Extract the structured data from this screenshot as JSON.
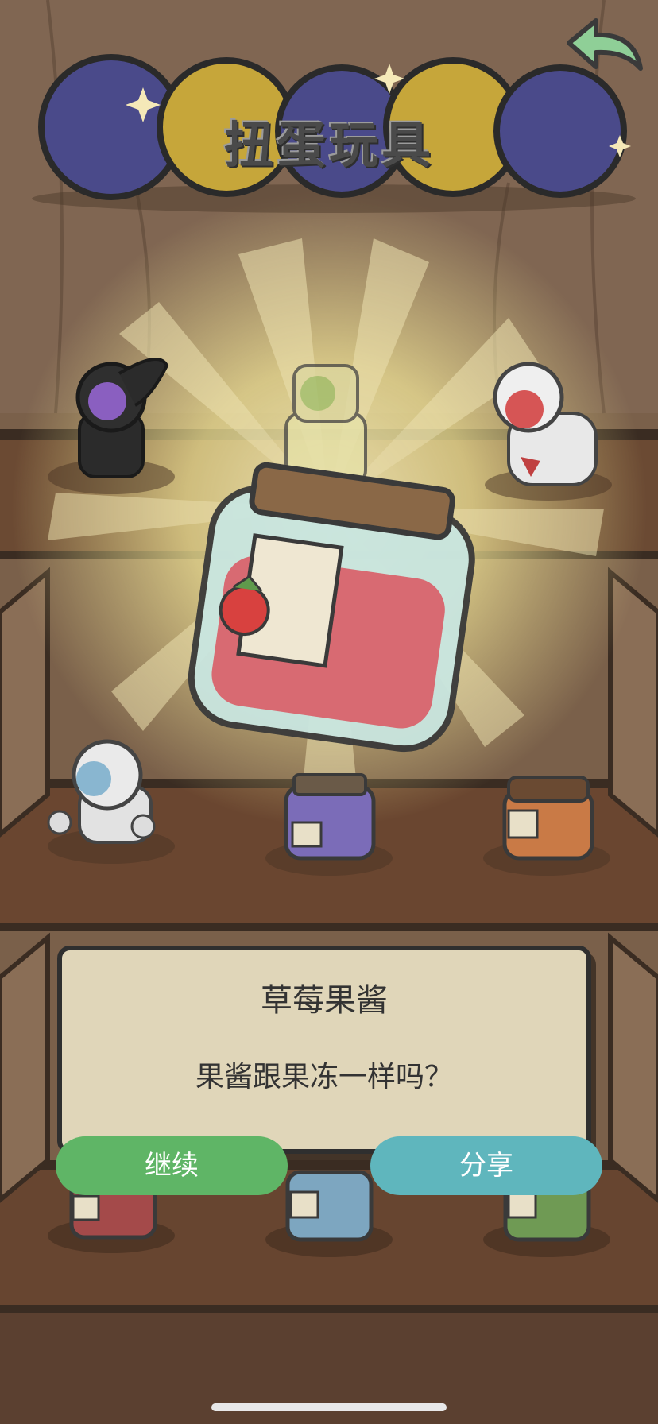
{
  "header": {
    "title": "扭蛋玩具",
    "back_icon": "back-arrow-icon",
    "back_color": "#8fcf97"
  },
  "reward": {
    "item_name": "草莓果酱",
    "item_icon": "strawberry-jam-jar-icon",
    "description": "果酱跟果冻一样吗？"
  },
  "buttons": {
    "continue_label": "继续",
    "continue_color": "#5fb566",
    "share_label": "分享",
    "share_color": "#5fb6bd"
  },
  "shelf_items": [
    "black-astronaut-icon",
    "yellow-robot-icon",
    "white-red-astronaut-icon",
    "blue-visor-robot-icon",
    "purple-jam-jar-icon",
    "orange-jam-jar-icon",
    "red-jam-jar-icon",
    "blue-jam-jar-icon",
    "green-jam-jar-icon"
  ]
}
